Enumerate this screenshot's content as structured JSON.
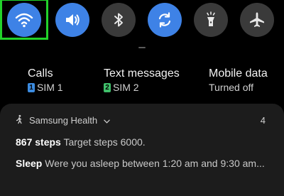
{
  "quick_settings": {
    "tiles": [
      {
        "name": "wifi",
        "icon": "wifi-icon",
        "state": "on"
      },
      {
        "name": "sound",
        "icon": "volume-icon",
        "state": "on"
      },
      {
        "name": "bluetooth",
        "icon": "bluetooth-icon",
        "state": "off"
      },
      {
        "name": "auto-rotate",
        "icon": "rotate-icon",
        "state": "on"
      },
      {
        "name": "flashlight",
        "icon": "flashlight-icon",
        "state": "off"
      },
      {
        "name": "airplane-mode",
        "icon": "airplane-icon",
        "state": "off"
      }
    ],
    "highlight_color": "#22d32a",
    "active_color": "#3e82e6"
  },
  "sim_info": {
    "calls": {
      "label": "Calls",
      "sim_number": "1",
      "sim_label": "SIM 1",
      "badge_color": "#3b8be0"
    },
    "texts": {
      "label": "Text messages",
      "sim_number": "2",
      "sim_label": "SIM 2",
      "badge_color": "#3fbf6a"
    },
    "mobile_data": {
      "label": "Mobile data",
      "status": "Turned off"
    }
  },
  "notification": {
    "app_name": "Samsung Health",
    "app_icon": "walking-person-icon",
    "count": "4",
    "lines": [
      {
        "bold": "867 steps",
        "text": "Target steps 6000."
      },
      {
        "bold": "Sleep",
        "text": "Were you asleep between 1:20 am and 9:30 am..."
      }
    ]
  }
}
